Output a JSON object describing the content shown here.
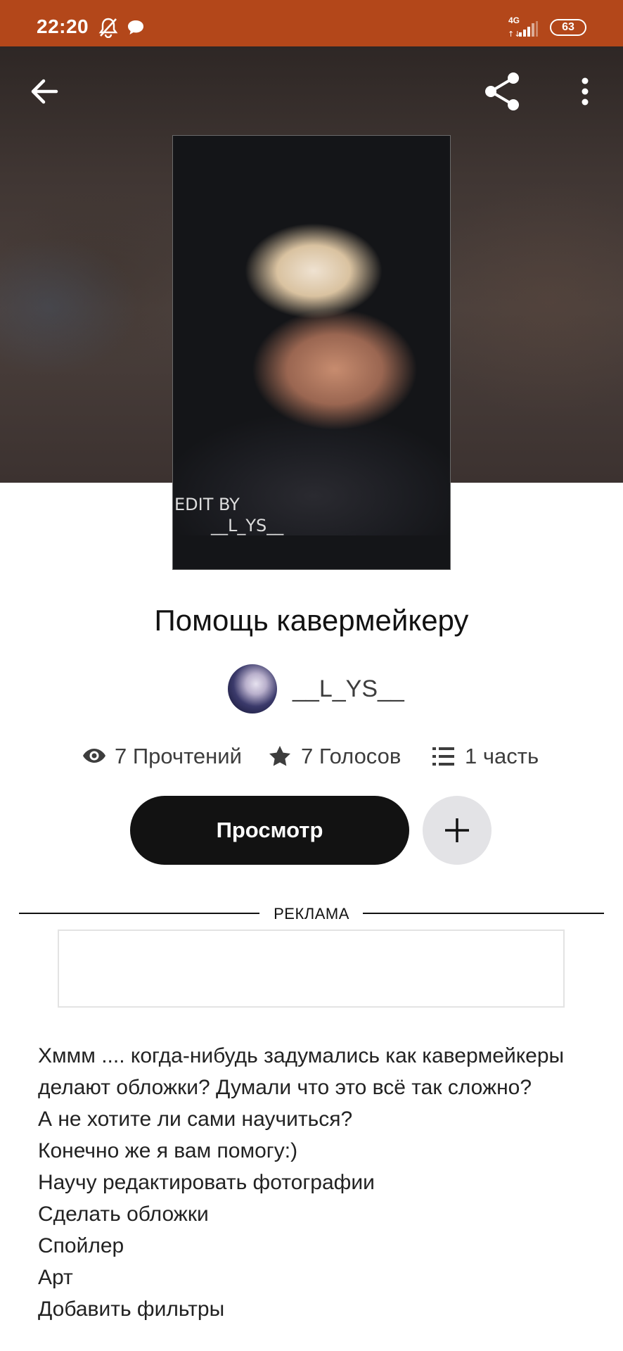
{
  "status_bar": {
    "time": "22:20",
    "network": "4G",
    "battery": "63",
    "icons": [
      "bell-off-icon",
      "chat-bubble-icon",
      "signal-icon",
      "battery-icon"
    ]
  },
  "toolbar": {
    "icons": [
      "back-arrow-icon",
      "share-icon",
      "more-vertical-icon"
    ]
  },
  "cover": {
    "edit_by_line1": "EDIT BY",
    "edit_by_line2": "__L_YS__"
  },
  "story": {
    "title": "Помощь кавермейкеру",
    "author": "__L_YS__",
    "stats": {
      "reads": "7 Прочтений",
      "votes": "7 Голосов",
      "parts": "1 часть"
    },
    "read_button": "Просмотр",
    "add_button_icon": "plus-icon"
  },
  "ad": {
    "label": "РЕКЛАМА"
  },
  "description": {
    "lines": [
      "Хммм .... когда-нибудь задумались как кавермейкеры делают обложки? Думали что это всё так сложно?",
      "А не хотите ли сами научиться?",
      "Конечно же я вам помогу:)",
      "Научу редактировать фотографии",
      "Сделать обложки",
      "Спойлер",
      "Арт",
      "Добавить фильтры"
    ]
  },
  "colors": {
    "status_bar": "#b3471a",
    "primary_button": "#121212",
    "secondary_button": "#e3e3e6"
  }
}
